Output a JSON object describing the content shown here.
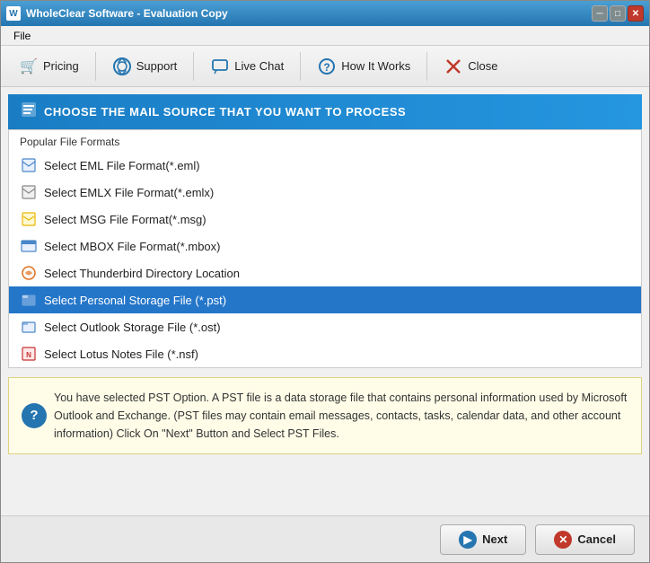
{
  "window": {
    "title": "WholeClear Software - Evaluation Copy",
    "title_icon": "W"
  },
  "menu": {
    "items": [
      {
        "label": "File"
      }
    ]
  },
  "toolbar": {
    "buttons": [
      {
        "id": "pricing",
        "label": "Pricing",
        "icon": "🛒"
      },
      {
        "id": "support",
        "label": "Support",
        "icon": "💬"
      },
      {
        "id": "live-chat",
        "label": "Live Chat",
        "icon": "💬"
      },
      {
        "id": "how-it-works",
        "label": "How It Works",
        "icon": "❓"
      },
      {
        "id": "close",
        "label": "Close",
        "icon": "✕"
      }
    ]
  },
  "section": {
    "header": "CHOOSE THE MAIL SOURCE THAT YOU WANT TO PROCESS",
    "group_label": "Popular File Formats",
    "items": [
      {
        "id": "eml",
        "label": "Select EML File Format(*.eml)",
        "icon_type": "eml"
      },
      {
        "id": "emlx",
        "label": "Select EMLX File Format(*.emlx)",
        "icon_type": "emlx"
      },
      {
        "id": "msg",
        "label": "Select MSG File Format(*.msg)",
        "icon_type": "msg"
      },
      {
        "id": "mbox",
        "label": "Select MBOX File Format(*.mbox)",
        "icon_type": "mbox"
      },
      {
        "id": "thunderbird",
        "label": "Select Thunderbird Directory Location",
        "icon_type": "thunderbird"
      },
      {
        "id": "pst",
        "label": "Select Personal Storage File (*.pst)",
        "icon_type": "pst",
        "selected": true
      },
      {
        "id": "ost",
        "label": "Select Outlook Storage File (*.ost)",
        "icon_type": "ost"
      },
      {
        "id": "nsf",
        "label": "Select Lotus Notes File (*.nsf)",
        "icon_type": "nsf"
      }
    ]
  },
  "info_box": {
    "text": "You have selected PST Option. A PST file is a data storage file that contains personal information used by Microsoft Outlook and Exchange. (PST files may contain email messages, contacts, tasks, calendar data, and other account information) Click On \"Next\" Button and Select PST Files."
  },
  "footer": {
    "next_label": "Next",
    "cancel_label": "Cancel"
  }
}
